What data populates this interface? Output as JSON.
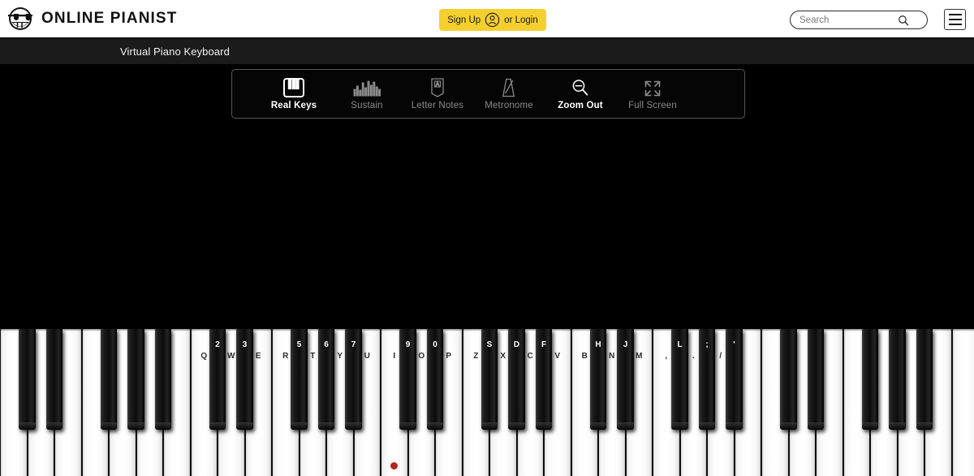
{
  "header": {
    "brand_text": "ONLINE PIANIST",
    "brand_icon": "pianist-face-logo",
    "auth": {
      "signup_label": "Sign Up",
      "avatar_icon": "user-circle-icon",
      "login_label": "or Login",
      "bg_color": "#f5cf2e"
    },
    "search": {
      "placeholder": "Search",
      "value": "",
      "icon": "search-icon"
    },
    "menu_icon": "hamburger-menu-icon"
  },
  "subnav": {
    "title": "Virtual Piano Keyboard",
    "bg_color": "#1b1b1b"
  },
  "toolbar": {
    "items": [
      {
        "id": "real-keys",
        "label": "Real Keys",
        "icon": "piano-keys-icon",
        "state": "active"
      },
      {
        "id": "sustain",
        "label": "Sustain",
        "icon": "sound-bars-icon",
        "state": "dim"
      },
      {
        "id": "letter-notes",
        "label": "Letter Notes",
        "icon": "letter-page-icon",
        "state": "dim"
      },
      {
        "id": "metronome",
        "label": "Metronome",
        "icon": "metronome-icon",
        "state": "dim"
      },
      {
        "id": "zoom-out",
        "label": "Zoom Out",
        "icon": "zoom-out-icon",
        "state": "active"
      },
      {
        "id": "full-screen",
        "label": "Full Screen",
        "icon": "fullscreen-icon",
        "state": "dim"
      }
    ],
    "active_color": "#ffffff",
    "dim_color": "#8a8a8a"
  },
  "piano": {
    "white_key_count": 36,
    "white_key_width": 33.5,
    "start_x": 0,
    "middle_c_marker": {
      "white_index": 14,
      "color": "#b3261e"
    },
    "octave_pattern_white": [
      "C",
      "D",
      "E",
      "F",
      "G",
      "A",
      "B"
    ],
    "octave_pattern_black_after": [
      0,
      1,
      3,
      4,
      5
    ],
    "labels_start_white_index": 7,
    "white_labels": [
      "Q",
      "W",
      "E",
      "R",
      "T",
      "Y",
      "U",
      "I",
      "O",
      "P",
      "Z",
      "X",
      "C",
      "V",
      "B",
      "N",
      "M",
      ",",
      ".",
      "/"
    ],
    "black_labels": [
      "2",
      "3",
      "5",
      "6",
      "7",
      "9",
      "0",
      "S",
      "D",
      "F",
      "H",
      "J",
      "L",
      ";",
      "'"
    ],
    "white_label_map": {
      "7": "Q",
      "8": "W",
      "9": "E",
      "10": "R",
      "11": "T",
      "12": "Y",
      "13": "U",
      "14": "I",
      "15": "O",
      "16": "P",
      "17": "Z",
      "18": "X",
      "19": "C",
      "20": "V",
      "21": "B",
      "22": "N",
      "23": "M",
      "24": ",",
      "25": ".",
      "26": "/"
    },
    "black_label_map": {
      "7": "2",
      "8": "3",
      "10": "5",
      "11": "6",
      "12": "7",
      "14": "9",
      "15": "0",
      "17": "S",
      "18": "D",
      "19": "F",
      "21": "H",
      "22": "J",
      "24": "L",
      "25": ";",
      "26": "'"
    }
  }
}
